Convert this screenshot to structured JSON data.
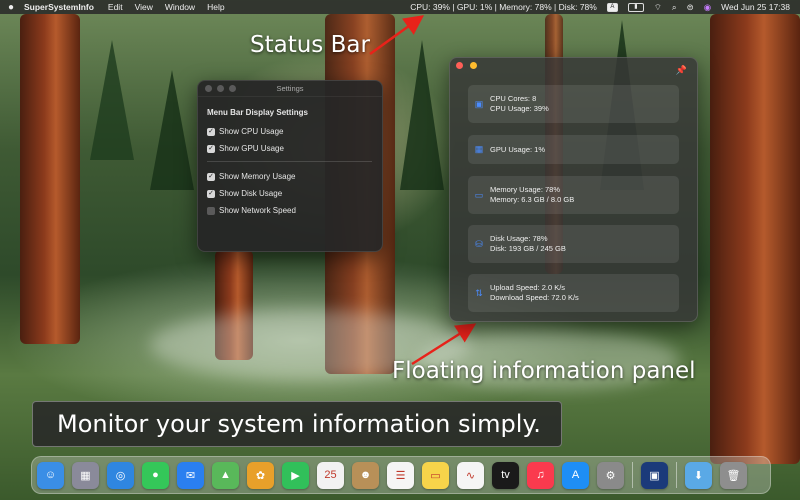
{
  "menubar": {
    "app_name": "SuperSystemInfo",
    "menus": [
      "Edit",
      "View",
      "Window",
      "Help"
    ],
    "status_text": "CPU: 39% | GPU: 1% | Memory: 78% | Disk: 78%",
    "input_badge": "A",
    "datetime": "Wed Jun 25  17:38",
    "icons": [
      "apple-icon",
      "keyboard-input-icon",
      "battery-icon",
      "wifi-icon",
      "search-icon",
      "control-center-icon",
      "siri-icon"
    ]
  },
  "annotations": {
    "status_bar": "Status Bar",
    "floating_panel": "Floating information panel",
    "tagline": "Monitor your system information simply.",
    "arrow_color": "#e8221a"
  },
  "settings": {
    "title": "Settings",
    "heading": "Menu Bar Display Settings",
    "options": [
      {
        "label": "Show CPU Usage",
        "checked": true
      },
      {
        "label": "Show GPU Usage",
        "checked": true
      },
      {
        "label": "Show Memory Usage",
        "checked": true
      },
      {
        "label": "Show Disk Usage",
        "checked": true
      },
      {
        "label": "Show Network Speed",
        "checked": false
      }
    ]
  },
  "panel": {
    "accent": "#4a8cff",
    "cards": [
      {
        "icon": "cpu-icon",
        "lines": [
          "CPU Cores: 8",
          "CPU Usage: 39%"
        ]
      },
      {
        "icon": "gpu-icon",
        "lines": [
          "GPU Usage: 1%"
        ]
      },
      {
        "icon": "memory-icon",
        "lines": [
          "Memory Usage: 78%",
          "Memory: 6.3 GB / 8.0 GB"
        ]
      },
      {
        "icon": "disk-icon",
        "lines": [
          "Disk Usage: 78%",
          "Disk: 193 GB / 245 GB"
        ]
      },
      {
        "icon": "network-icon",
        "lines": [
          "Upload Speed: 2.0 K/s",
          "Download Speed: 72.0 K/s"
        ]
      }
    ]
  },
  "dock": {
    "apps": [
      {
        "name": "finder-icon",
        "glyph": "☺",
        "color": "#3a8ee6"
      },
      {
        "name": "launchpad-icon",
        "glyph": "▦",
        "color": "#8a8a9a"
      },
      {
        "name": "safari-icon",
        "glyph": "◎",
        "color": "#2f86e0"
      },
      {
        "name": "messages-icon",
        "glyph": "●",
        "color": "#34c759"
      },
      {
        "name": "mail-icon",
        "glyph": "✉",
        "color": "#2a7ff0"
      },
      {
        "name": "maps-icon",
        "glyph": "▲",
        "color": "#59b85a"
      },
      {
        "name": "photos-icon",
        "glyph": "✿",
        "color": "#e8a02a"
      },
      {
        "name": "facetime-icon",
        "glyph": "▶",
        "color": "#31c05a"
      },
      {
        "name": "calendar-icon",
        "glyph": "25",
        "color": "#f2f2f2"
      },
      {
        "name": "contacts-icon",
        "glyph": "☻",
        "color": "#b89058"
      },
      {
        "name": "reminders-icon",
        "glyph": "☰",
        "color": "#f5f5f5"
      },
      {
        "name": "notes-icon",
        "glyph": "▭",
        "color": "#f7d44a"
      },
      {
        "name": "freeform-icon",
        "glyph": "∿",
        "color": "#f5f5f5"
      },
      {
        "name": "tv-icon",
        "glyph": "tv",
        "color": "#1a1a1a"
      },
      {
        "name": "music-icon",
        "glyph": "♫",
        "color": "#fa3a4e"
      },
      {
        "name": "app-store-icon",
        "glyph": "A",
        "color": "#1e8ef5"
      },
      {
        "name": "system-settings-icon",
        "glyph": "⚙",
        "color": "#8a8a8a"
      }
    ],
    "pinned": [
      {
        "name": "supersysteminfo-icon",
        "glyph": "▣",
        "color": "#1b3a7a"
      }
    ],
    "tail": [
      {
        "name": "downloads-folder-icon",
        "glyph": "⬇",
        "color": "#5aa9e6"
      },
      {
        "name": "trash-icon",
        "glyph": "🗑",
        "color": "#8e8e8e"
      }
    ]
  }
}
